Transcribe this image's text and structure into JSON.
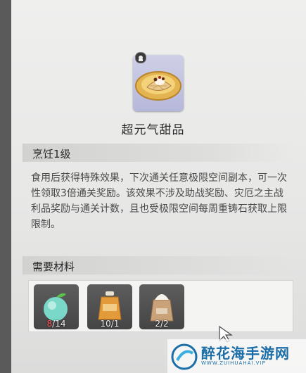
{
  "item": {
    "name": "超元气甜品"
  },
  "effect_section": {
    "title": "烹饪1级"
  },
  "description": "食用后获得特殊效果，下次通关任意极限空间副本，可一次性领取3倍通关奖励。该效果不涉及助战奖励、灾厄之主战利品奖励与通关计数，且也受极限空间每周重铸石获取上限限制。",
  "materials_section": {
    "title": "需要材料",
    "items": [
      {
        "icon": "green-apple-icon",
        "owned": "8",
        "required": "14",
        "sufficient": false
      },
      {
        "icon": "honey-jar-icon",
        "owned": "10",
        "required": "1",
        "sufficient": true
      },
      {
        "icon": "flour-sack-icon",
        "owned": "2",
        "required": "2",
        "sufficient": true
      }
    ]
  },
  "watermark": {
    "title": "醉花海手游网",
    "url": "WWW.ZUIHUAHAI.VIP"
  },
  "colors": {
    "accent": "#b6b8db",
    "shortage": "#ff5a5a",
    "watermark": "#1c6ea8"
  }
}
